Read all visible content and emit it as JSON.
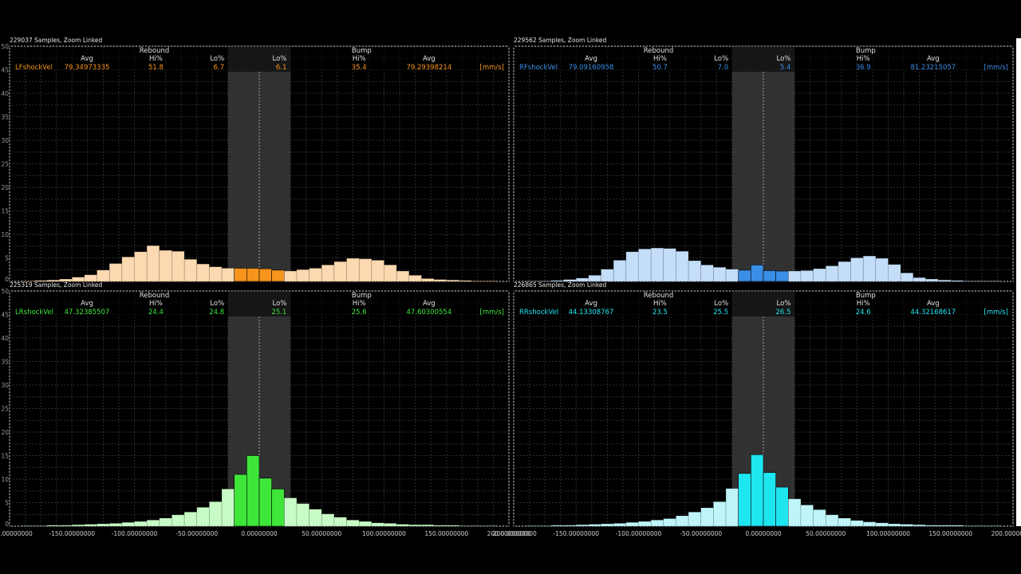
{
  "chart_data": [
    {
      "type": "bar",
      "samples_label": "229037 Samples, Zoom Linked",
      "channel": "LFshockVel",
      "unit": "[mm/s]",
      "color": "#f7941d",
      "color_light": "#fcd9b0",
      "rebound_label": "Rebound",
      "bump_label": "Bump",
      "stats": {
        "rebound": {
          "avg_label": "Avg",
          "avg": "79.34973335",
          "hi_label": "Hi%",
          "hi": "51.8",
          "lo_label": "Lo%",
          "lo": "6.7"
        },
        "bump": {
          "lo_label": "Lo%",
          "lo": "6.1",
          "hi_label": "Hi%",
          "hi": "35.4",
          "avg_label": "Avg",
          "avg": "79.29398214"
        }
      },
      "x_ticks": [],
      "y_ticks": [
        "0",
        "5",
        "10",
        "15",
        "20",
        "25",
        "30",
        "35",
        "40",
        "45",
        "50"
      ],
      "xlim": [
        -200,
        200
      ],
      "ylim": [
        0,
        50
      ],
      "low_speed_band": [
        -25,
        25
      ],
      "bin_width": 10,
      "x": [
        -185,
        -175,
        -165,
        -155,
        -145,
        -135,
        -125,
        -115,
        -105,
        -95,
        -85,
        -75,
        -65,
        -55,
        -45,
        -35,
        -25,
        -15,
        -5,
        5,
        15,
        25,
        35,
        45,
        55,
        65,
        75,
        85,
        95,
        105,
        115,
        125,
        135,
        145,
        155,
        165,
        175,
        185
      ],
      "values": [
        0.1,
        0.2,
        0.3,
        0.5,
        0.9,
        1.4,
        2.4,
        3.8,
        5.2,
        6.3,
        7.6,
        6.6,
        6.4,
        4.7,
        3.7,
        3.1,
        2.8,
        2.8,
        2.8,
        2.7,
        2.4,
        2.2,
        2.5,
        2.8,
        3.5,
        4.2,
        4.9,
        4.8,
        4.5,
        3.5,
        2.2,
        1.3,
        0.6,
        0.4,
        0.3,
        0.2,
        0.1,
        0.1
      ]
    },
    {
      "type": "bar",
      "samples_label": "229562 Samples, Zoom Linked",
      "channel": "RFshockVel",
      "unit": "[mm/s]",
      "color": "#3a8ee6",
      "color_light": "#c4defa",
      "rebound_label": "Rebound",
      "bump_label": "Bump",
      "stats": {
        "rebound": {
          "avg_label": "Avg",
          "avg": "79.09160958",
          "hi_label": "Hi%",
          "hi": "50.7",
          "lo_label": "Lo%",
          "lo": "7.0"
        },
        "bump": {
          "lo_label": "Lo%",
          "lo": "5.4",
          "hi_label": "Hi%",
          "hi": "36.9",
          "avg_label": "Avg",
          "avg": "81.23215057"
        }
      },
      "x_ticks": [],
      "y_ticks": [],
      "xlim": [
        -200,
        200
      ],
      "ylim": [
        0,
        50
      ],
      "low_speed_band": [
        -25,
        25
      ],
      "bin_width": 10,
      "x": [
        -185,
        -175,
        -165,
        -155,
        -145,
        -135,
        -125,
        -115,
        -105,
        -95,
        -85,
        -75,
        -65,
        -55,
        -45,
        -35,
        -25,
        -15,
        -5,
        5,
        15,
        25,
        35,
        45,
        55,
        65,
        75,
        85,
        95,
        105,
        115,
        125,
        135,
        145,
        155,
        165,
        175,
        185
      ],
      "values": [
        0.1,
        0.1,
        0.2,
        0.4,
        0.7,
        1.3,
        2.6,
        4.5,
        6.3,
        6.9,
        7.1,
        7.0,
        6.4,
        4.4,
        3.5,
        3.0,
        2.6,
        2.4,
        3.5,
        2.3,
        2.2,
        2.2,
        2.3,
        2.7,
        3.3,
        4.2,
        5.0,
        5.4,
        4.9,
        3.6,
        1.8,
        0.8,
        0.5,
        0.3,
        0.2,
        0.1,
        0.1,
        0.1
      ]
    },
    {
      "type": "bar",
      "samples_label": "225319 Samples, Zoom Linked",
      "channel": "LRshockVel",
      "unit": "[mm/s]",
      "color": "#3ee63a",
      "color_light": "#c8fcc6",
      "rebound_label": "Rebound",
      "bump_label": "Bump",
      "stats": {
        "rebound": {
          "avg_label": "Avg",
          "avg": "47.32385507",
          "hi_label": "Hi%",
          "hi": "24.4",
          "lo_label": "Lo%",
          "lo": "24.8"
        },
        "bump": {
          "lo_label": "Lo%",
          "lo": "25.1",
          "hi_label": "Hi%",
          "hi": "25.6",
          "avg_label": "Avg",
          "avg": "47.60300554"
        }
      },
      "x_ticks": [
        "-200.00000000",
        "-150.00000000",
        "-100.00000000",
        "-50.00000000",
        "0.00000000",
        "50.00000000",
        "100.00000000",
        "150.00000000",
        "200.00000000"
      ],
      "y_ticks": [
        "0",
        "5",
        "10",
        "15",
        "20",
        "25",
        "30",
        "35",
        "40",
        "45",
        "50"
      ],
      "xlim": [
        -200,
        200
      ],
      "ylim": [
        0,
        50
      ],
      "low_speed_band": [
        -25,
        25
      ],
      "bin_width": 10,
      "x": [
        -185,
        -175,
        -165,
        -155,
        -145,
        -135,
        -125,
        -115,
        -105,
        -95,
        -85,
        -75,
        -65,
        -55,
        -45,
        -35,
        -25,
        -15,
        -5,
        5,
        15,
        25,
        35,
        45,
        55,
        65,
        75,
        85,
        95,
        105,
        115,
        125,
        135,
        145,
        155,
        165,
        175,
        185
      ],
      "values": [
        0.1,
        0.1,
        0.2,
        0.2,
        0.3,
        0.4,
        0.5,
        0.6,
        0.8,
        1.0,
        1.3,
        1.7,
        2.4,
        3.0,
        4.0,
        5.2,
        7.9,
        11.0,
        15.0,
        10.2,
        7.9,
        6.0,
        4.8,
        3.6,
        2.6,
        1.9,
        1.3,
        1.0,
        0.7,
        0.6,
        0.4,
        0.3,
        0.3,
        0.2,
        0.2,
        0.1,
        0.1,
        0.1
      ]
    },
    {
      "type": "bar",
      "samples_label": "226865 Samples, Zoom Linked",
      "channel": "RRshockVel",
      "unit": "[mm/s]",
      "color": "#1ee6f0",
      "color_light": "#bff5f9",
      "rebound_label": "Rebound",
      "bump_label": "Bump",
      "stats": {
        "rebound": {
          "avg_label": "Avg",
          "avg": "44.13308767",
          "hi_label": "Hi%",
          "hi": "23.5",
          "lo_label": "Lo%",
          "lo": "25.5"
        },
        "bump": {
          "lo_label": "Lo%",
          "lo": "26.5",
          "hi_label": "Hi%",
          "hi": "24.6",
          "avg_label": "Avg",
          "avg": "44.32168617"
        }
      },
      "x_ticks": [
        "-200.00000000",
        "-150.00000000",
        "-100.00000000",
        "-50.00000000",
        "0.00000000",
        "50.00000000",
        "100.00000000",
        "150.00000000",
        "200.00000000"
      ],
      "y_ticks": [],
      "xlim": [
        -200,
        200
      ],
      "ylim": [
        0,
        50
      ],
      "low_speed_band": [
        -25,
        25
      ],
      "bin_width": 10,
      "x": [
        -185,
        -175,
        -165,
        -155,
        -145,
        -135,
        -125,
        -115,
        -105,
        -95,
        -85,
        -75,
        -65,
        -55,
        -45,
        -35,
        -25,
        -15,
        -5,
        5,
        15,
        25,
        35,
        45,
        55,
        65,
        75,
        85,
        95,
        105,
        115,
        125,
        135,
        145,
        155,
        165,
        175,
        185
      ],
      "values": [
        0.1,
        0.1,
        0.2,
        0.2,
        0.3,
        0.4,
        0.5,
        0.6,
        0.8,
        1.0,
        1.3,
        1.6,
        2.2,
        3.0,
        3.9,
        5.2,
        8.0,
        11.2,
        15.2,
        11.4,
        8.3,
        5.8,
        4.5,
        3.5,
        2.4,
        1.7,
        1.2,
        0.9,
        0.7,
        0.5,
        0.4,
        0.3,
        0.2,
        0.2,
        0.2,
        0.1,
        0.1,
        0.1
      ]
    }
  ]
}
